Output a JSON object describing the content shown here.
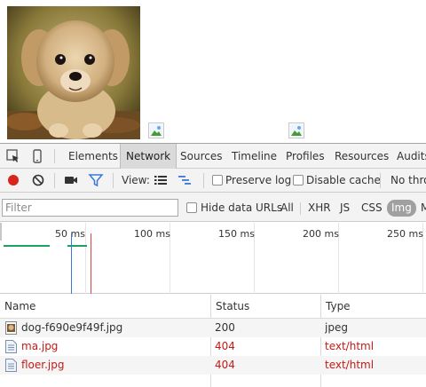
{
  "devtools": {
    "tabs": [
      {
        "label": "Elements"
      },
      {
        "label": "Network"
      },
      {
        "label": "Sources"
      },
      {
        "label": "Timeline"
      },
      {
        "label": "Profiles"
      },
      {
        "label": "Resources"
      },
      {
        "label": "Audits"
      }
    ],
    "selected_tab": "Network",
    "toolbar": {
      "view_label": "View:",
      "preserve_log_label": "Preserve log",
      "disable_cache_label": "Disable cache",
      "throttle_label": "No thro"
    },
    "filter": {
      "placeholder": "Filter",
      "hide_data_urls_label": "Hide data URLs",
      "types": [
        "All",
        "XHR",
        "JS",
        "CSS",
        "Img",
        "M"
      ],
      "selected_type": "Img"
    },
    "timeline": {
      "ticks": [
        "50 ms",
        "100 ms",
        "150 ms",
        "200 ms",
        "250 ms"
      ]
    },
    "table": {
      "columns": {
        "name": "Name",
        "status": "Status",
        "type": "Type"
      },
      "rows": [
        {
          "name": "dog-f690e9f49f.jpg",
          "status": "200",
          "type": "jpeg",
          "error": false,
          "icon": "image-file-icon"
        },
        {
          "name": "ma.jpg",
          "status": "404",
          "type": "text/html",
          "error": true,
          "icon": "document-file-icon"
        },
        {
          "name": "floer.jpg",
          "status": "404",
          "type": "text/html",
          "error": true,
          "icon": "document-file-icon"
        }
      ]
    }
  },
  "colors": {
    "error": "#c41a16",
    "record": "#d9261c",
    "accent": "#3879d9"
  }
}
